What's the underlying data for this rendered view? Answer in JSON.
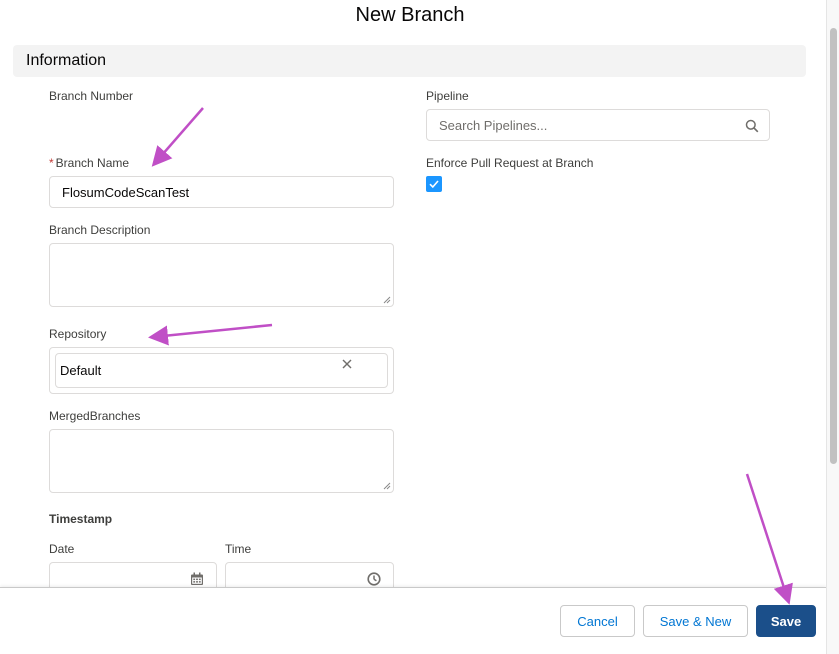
{
  "modal": {
    "title": "New Branch"
  },
  "section": {
    "title": "Information"
  },
  "fields": {
    "branch_number_label": "Branch Number",
    "branch_name_required": "*",
    "branch_name_label": "Branch Name",
    "branch_name_value": "FlosumCodeScanTest",
    "branch_description_label": "Branch Description",
    "repository_label": "Repository",
    "repository_value": "Default",
    "merged_branches_label": "MergedBranches",
    "timestamp_label": "Timestamp",
    "date_label": "Date",
    "time_label": "Time",
    "pipeline_label": "Pipeline",
    "pipeline_placeholder": "Search Pipelines...",
    "enforce_pr_label": "Enforce Pull Request at Branch",
    "enforce_pr_checked": true
  },
  "footer": {
    "cancel_label": "Cancel",
    "save_new_label": "Save & New",
    "save_label": "Save"
  },
  "colors": {
    "annotation_arrow": "#c04fc6",
    "brand_button": "#1b4f8a",
    "checkbox": "#1b96ff",
    "required": "#c23934"
  }
}
